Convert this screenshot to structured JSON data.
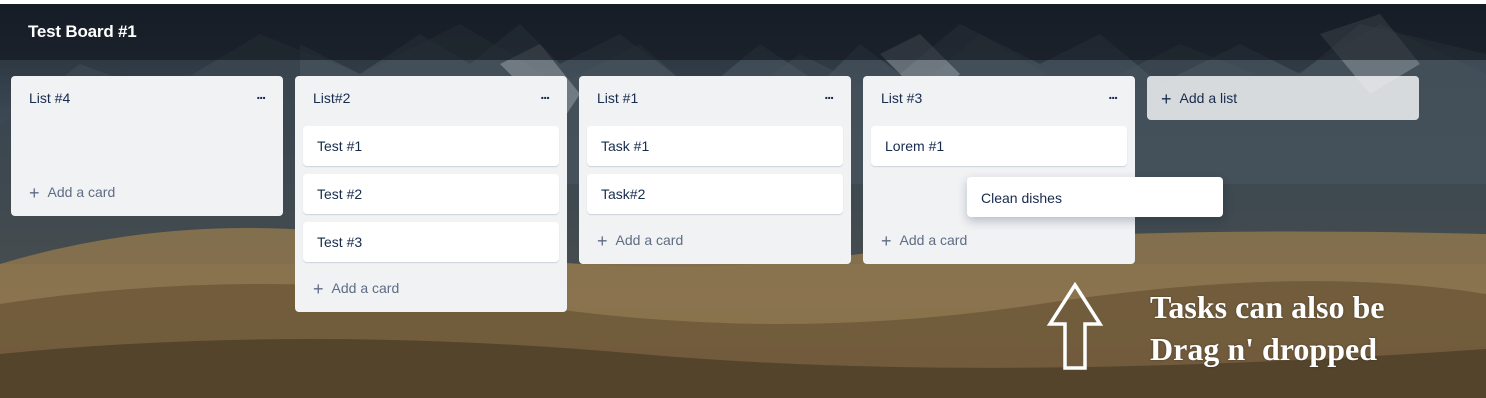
{
  "board": {
    "title": "Test Board #1"
  },
  "lists": [
    {
      "title": "List #4",
      "menu": "...",
      "cards": [],
      "add_card": "Add a card"
    },
    {
      "title": "List#2",
      "menu": "...",
      "cards": [
        "Test #1",
        "Test #2",
        "Test #3"
      ],
      "add_card": "Add a card"
    },
    {
      "title": "List #1",
      "menu": "...",
      "cards": [
        "Task #1",
        "Task#2"
      ],
      "add_card": "Add a card"
    },
    {
      "title": "List #3",
      "menu": "...",
      "cards": [
        "Lorem #1"
      ],
      "add_card": "Add a card"
    }
  ],
  "add_list": {
    "label": "Add a list"
  },
  "dragging_card": {
    "label": "Clean dishes"
  },
  "annotation": {
    "line1": "Tasks can also be",
    "line2": "Drag n' dropped"
  },
  "icons": {
    "plus": "+",
    "menu": "..."
  },
  "colors": {
    "list_bg": "#f1f2f4",
    "card_bg": "#ffffff",
    "text": "#172b4d",
    "muted": "#5e6c84"
  }
}
